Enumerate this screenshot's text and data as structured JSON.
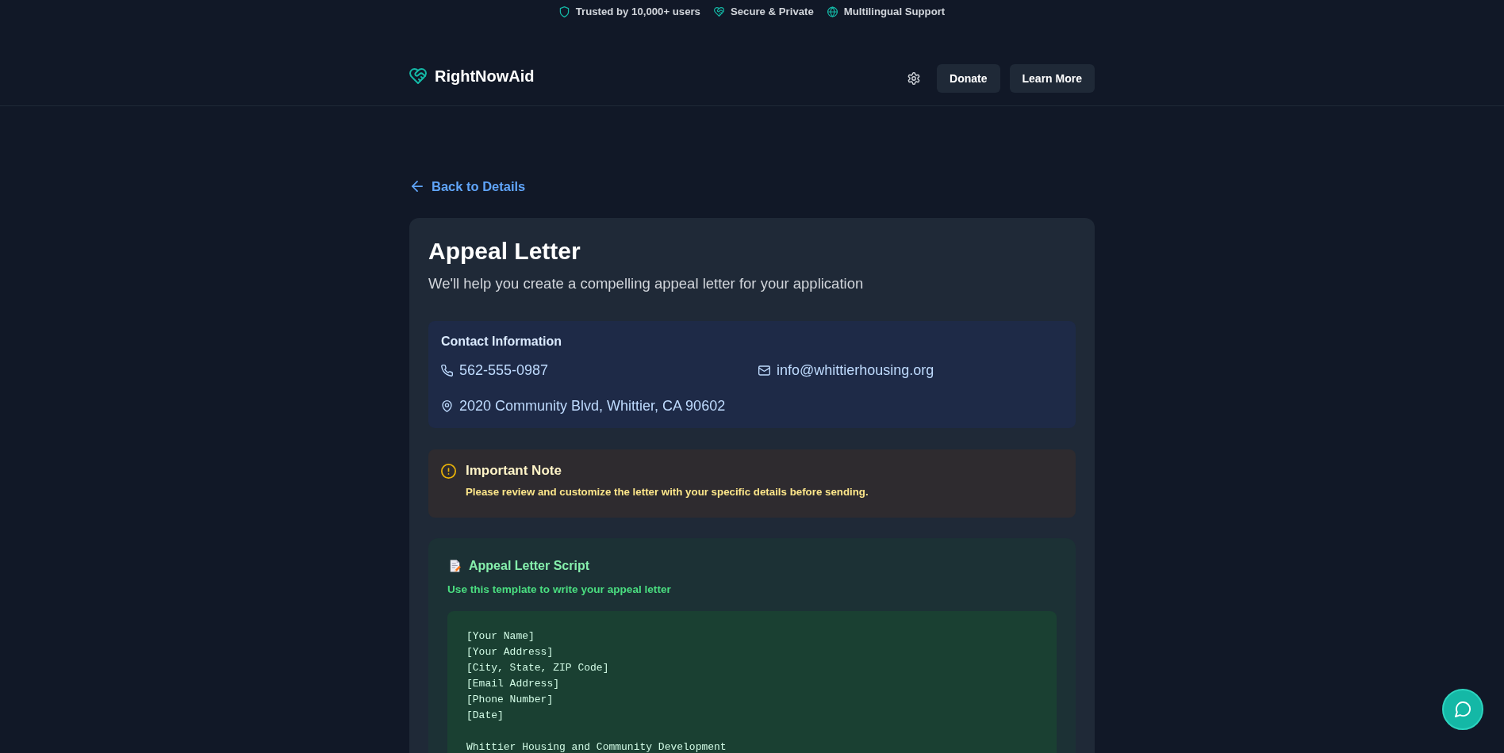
{
  "trust_bar": {
    "items": [
      {
        "kind": "shield",
        "label": "Trusted by 10,000+ users"
      },
      {
        "kind": "heart",
        "label": "Secure & Private"
      },
      {
        "kind": "globe",
        "label": "Multilingual Support"
      }
    ]
  },
  "header": {
    "brand": "RightNowAid",
    "buttons": [
      {
        "label": "Donate"
      },
      {
        "label": "Learn More"
      }
    ]
  },
  "back_link": {
    "label": "Back to Details"
  },
  "card": {
    "title": "Appeal Letter",
    "subtitle": "We'll help you create a compelling appeal letter for your application",
    "contact": {
      "heading": "Contact Information",
      "items": [
        {
          "kind": "phone",
          "value": "562-555-0987"
        },
        {
          "kind": "email",
          "value": "info@whittierhousing.org"
        },
        {
          "kind": "address",
          "value": "2020 Community Blvd, Whittier, CA 90602"
        }
      ]
    },
    "note": {
      "title": "Important Note",
      "text": "Please review and customize the letter with your specific details before sending."
    },
    "script": {
      "title": "Appeal Letter Script",
      "subtitle": "Use this template to write your appeal letter",
      "blocks": [
        [
          "[Your Name]",
          "[Your Address]",
          "[City, State, ZIP Code]",
          "[Email Address]",
          "[Phone Number]",
          "[Date]"
        ],
        [
          "Whittier Housing and Community Development"
        ]
      ]
    }
  }
}
